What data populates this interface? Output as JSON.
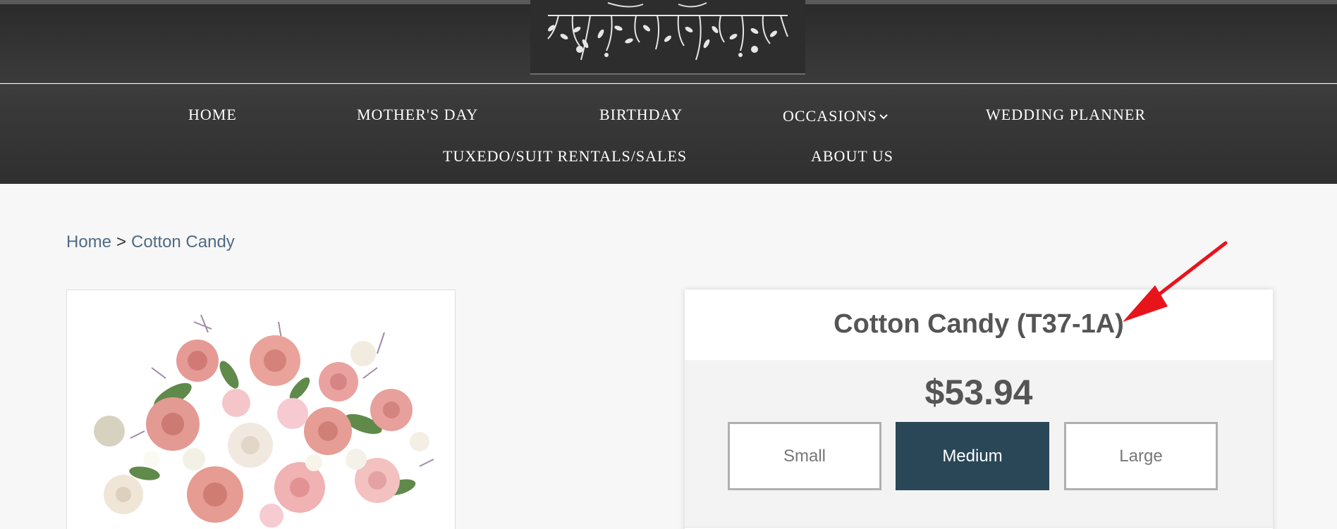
{
  "nav": {
    "row1": [
      "HOME",
      "MOTHER'S DAY",
      "BIRTHDAY",
      "OCCASIONS",
      "WEDDING PLANNER"
    ],
    "row2": [
      "TUXEDO/SUIT RENTALS/SALES",
      "ABOUT US"
    ]
  },
  "breadcrumb": {
    "home": "Home",
    "separator": ">",
    "current": "Cotton Candy"
  },
  "product": {
    "title": "Cotton Candy (T37-1A)",
    "price": "$53.94",
    "sizes": [
      "Small",
      "Medium",
      "Large"
    ],
    "selected_size": "Medium"
  },
  "colors": {
    "accent": "#294757",
    "arrow": "#e8141c",
    "header": "#333333"
  },
  "icons": {
    "occasions_dropdown": "chevron-down-icon",
    "annotation": "red-arrow-icon"
  }
}
